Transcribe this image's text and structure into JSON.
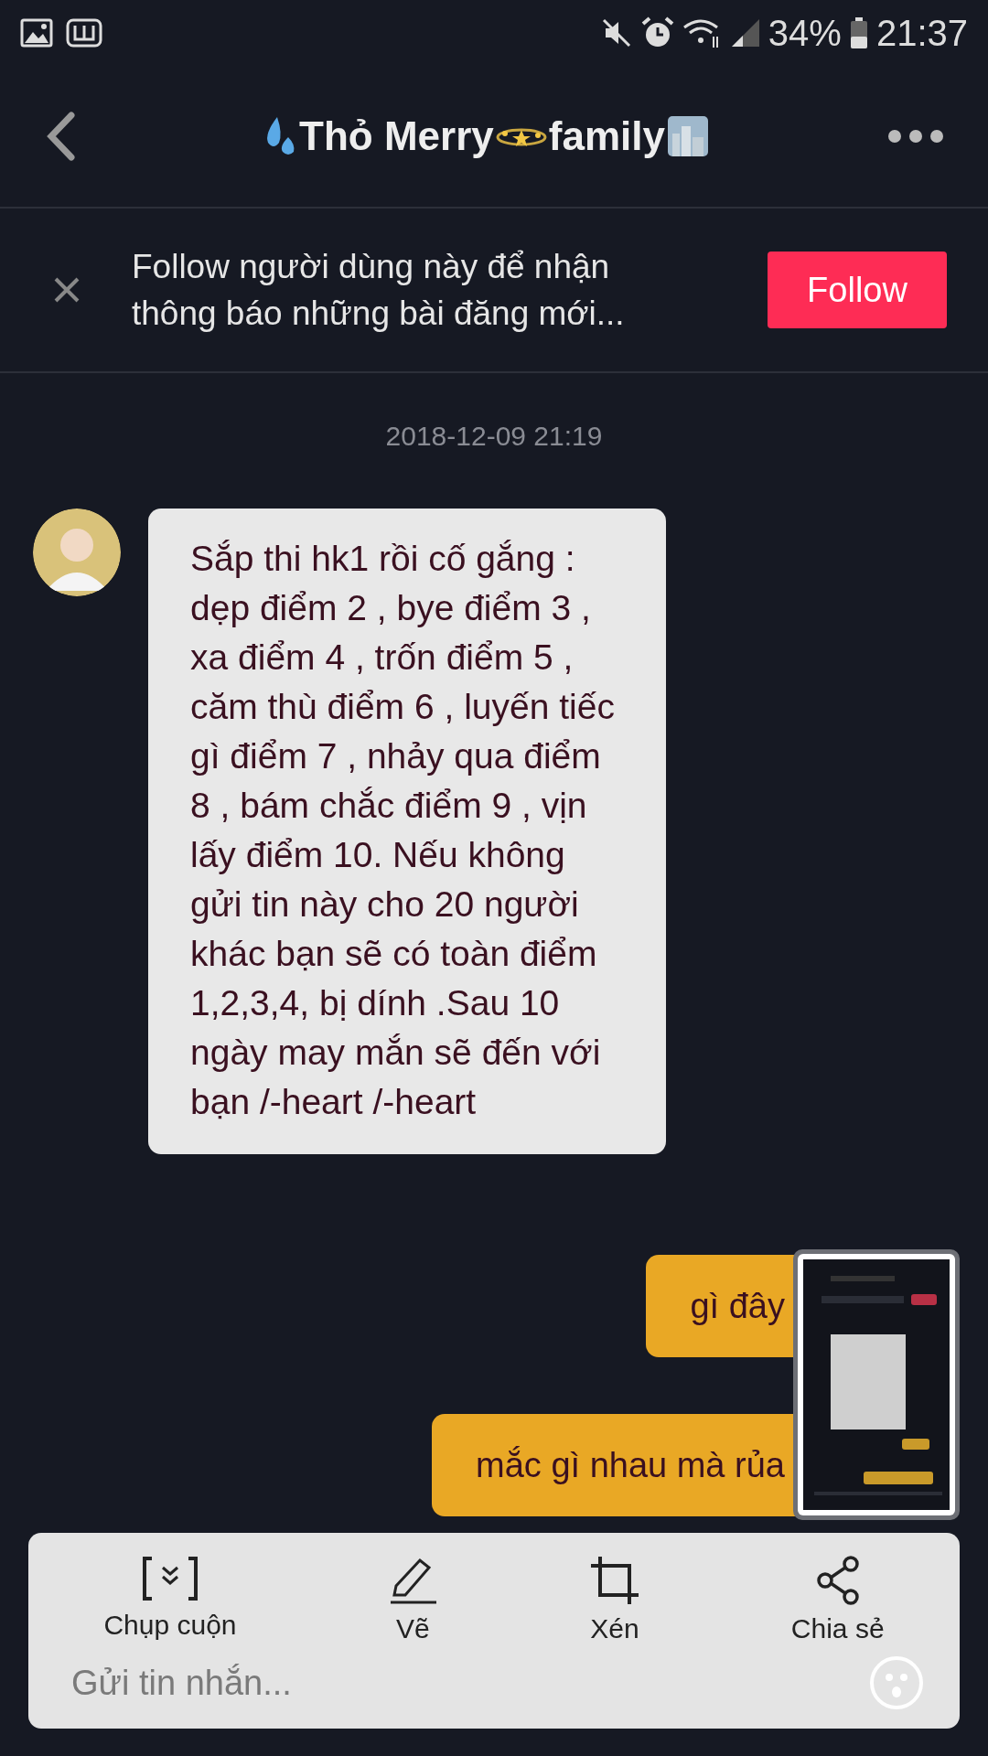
{
  "status_bar": {
    "battery": "34%",
    "time": "21:37"
  },
  "header": {
    "title_parts": [
      "Thỏ Merry",
      "family"
    ]
  },
  "follow_banner": {
    "text": "Follow người dùng này để nhận thông báo những bài đăng mới...",
    "button": "Follow"
  },
  "timestamp": "2018-12-09 21:19",
  "messages": [
    {
      "kind": "received",
      "text": "Sắp thi hk1 rồi cố gắng : dẹp điểm 2 , bye điểm 3 , xa điểm 4 , trốn điểm 5 , căm thù điểm 6 , luyến tiếc gì điểm 7 , nhảy qua điểm 8 , bám chắc điểm 9 , vịn lấy điểm 10. Nếu không gửi tin này cho 20 người khác bạn sẽ có toàn điểm 1,2,3,4, bị dính .Sau 10 ngày may mắn sẽ đến với bạn /-heart /-heart"
    },
    {
      "kind": "sent",
      "text": "gì đây"
    },
    {
      "kind": "sent",
      "text": "mắc gì nhau mà rủa"
    }
  ],
  "screenshot_toolbar": {
    "actions": [
      {
        "kind": "scroll",
        "label": "Chụp cuộn"
      },
      {
        "kind": "draw",
        "label": "Vẽ"
      },
      {
        "kind": "crop",
        "label": "Xén"
      },
      {
        "kind": "share",
        "label": "Chia sẻ"
      }
    ]
  },
  "composer": {
    "placeholder": "Gửi tin nhắn..."
  }
}
